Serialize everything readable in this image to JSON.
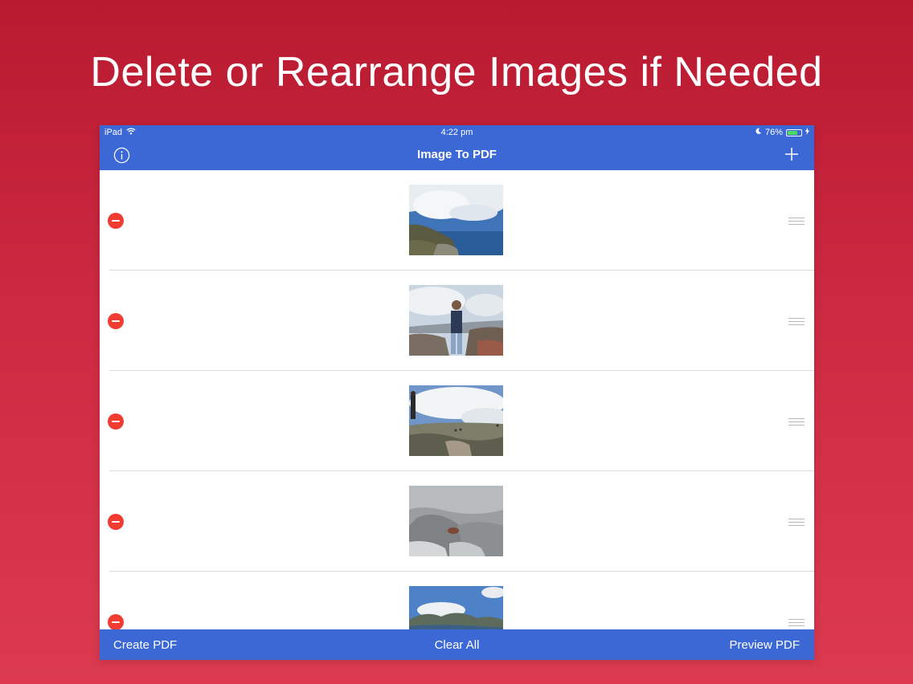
{
  "headline": "Delete or Rearrange Images if Needed",
  "status_bar": {
    "device": "iPad",
    "time": "4:22 pm",
    "battery": "76%",
    "battery_level": 0.76
  },
  "nav": {
    "title": "Image To PDF"
  },
  "toolbar": {
    "create_label": "Create PDF",
    "clear_label": "Clear All",
    "preview_label": "Preview PDF"
  },
  "colors": {
    "accent": "#3b68d4",
    "delete": "#f23c32",
    "background": "#c72640"
  },
  "icons": {
    "info": "info-icon",
    "add": "plus-icon",
    "delete": "minus-circle-icon",
    "reorder": "reorder-handle-icon"
  }
}
